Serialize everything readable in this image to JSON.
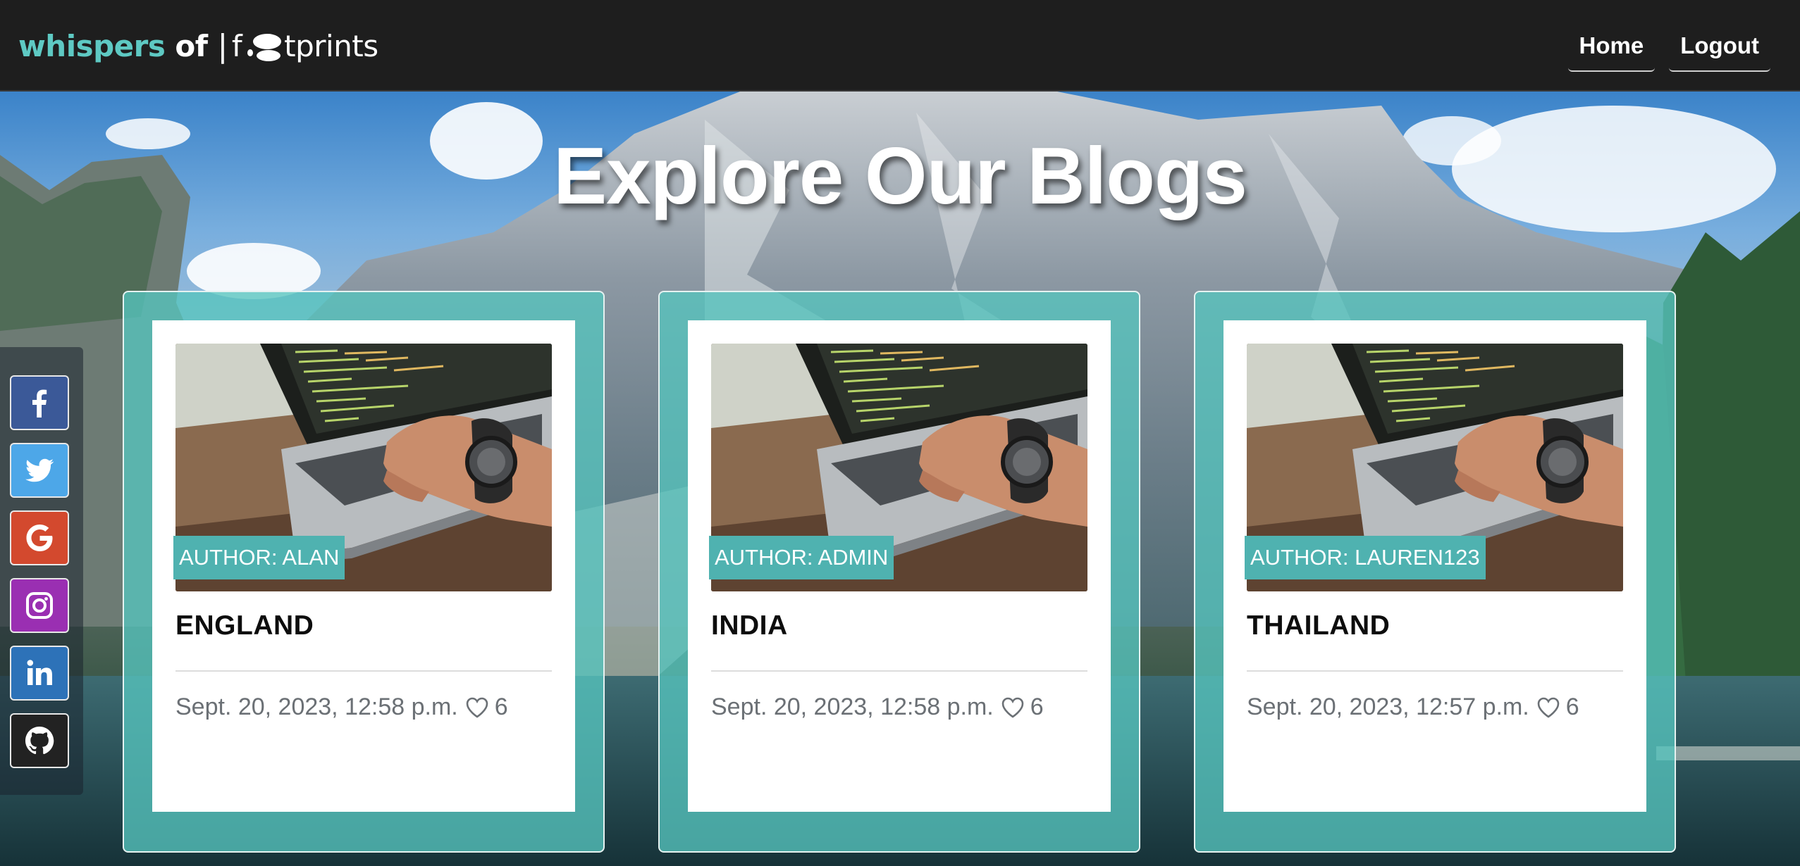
{
  "brand": {
    "part1": "whispers",
    "part2": "of",
    "bar": "|",
    "f": "f",
    "rest": "tprints"
  },
  "nav": {
    "home": "Home",
    "logout": "Logout"
  },
  "page_title": "Explore Our Blogs",
  "social": [
    {
      "icon": "facebook-icon",
      "color": "#3b5998"
    },
    {
      "icon": "twitter-icon",
      "color": "#4da7e8"
    },
    {
      "icon": "google-icon",
      "color": "#d3492e"
    },
    {
      "icon": "instagram-icon",
      "color": "#9a2fb2"
    },
    {
      "icon": "linkedin-icon",
      "color": "#2d72b8"
    },
    {
      "icon": "github-icon",
      "color": "#222222"
    }
  ],
  "posts": [
    {
      "author": "AUTHOR: ALAN",
      "title": "ENGLAND",
      "date": "Sept. 20, 2023, 12:58 p.m.",
      "likes": "6"
    },
    {
      "author": "AUTHOR: ADMIN",
      "title": "INDIA",
      "date": "Sept. 20, 2023, 12:58 p.m.",
      "likes": "6"
    },
    {
      "author": "AUTHOR: LAUREN123",
      "title": "THAILAND",
      "date": "Sept. 20, 2023, 12:57 p.m.",
      "likes": "6"
    }
  ],
  "colors": {
    "accent": "#5ec9c3",
    "navbar": "#1e1e1e",
    "badge": "#4fb2b0",
    "card_frame": "#56c4be"
  }
}
